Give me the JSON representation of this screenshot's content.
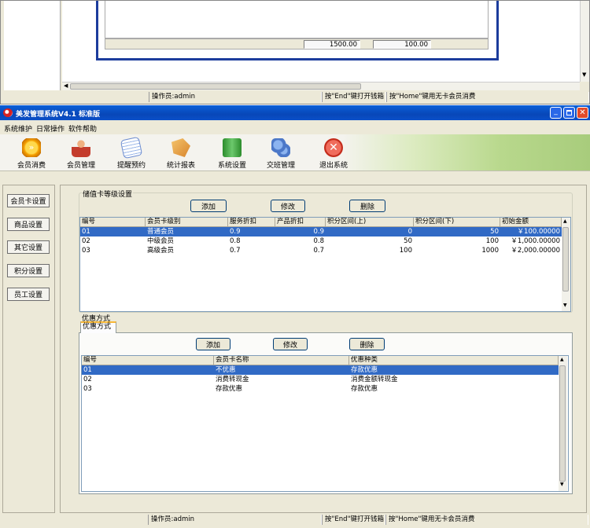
{
  "top_window": {
    "status_operator": "操作员:admin",
    "status_end": "按\"End\"键打开钱箱",
    "status_home": "按\"Home\"键用无卡会员消费",
    "totals": [
      "1500.00",
      "100.00"
    ]
  },
  "window": {
    "title": "美发管理系统V4.1 标准版",
    "menu": [
      "系统维护",
      "日常操作",
      "软件帮助"
    ],
    "toolbar": [
      {
        "label": "会员消费",
        "icon": "member-consume-icon",
        "color": "#f5a000"
      },
      {
        "label": "会员管理",
        "icon": "member-manage-icon",
        "color": "#c43c2c"
      },
      {
        "label": "提醒预约",
        "icon": "reminder-icon",
        "color": "#6c8cd0"
      },
      {
        "label": "统计报表",
        "icon": "report-icon",
        "color": "#d8842c"
      },
      {
        "label": "系统设置",
        "icon": "system-settings-icon",
        "color": "#3c9c3c"
      },
      {
        "label": "交班管理",
        "icon": "shift-handover-icon",
        "color": "#4c78c8"
      },
      {
        "label": "退出系统",
        "icon": "exit-icon",
        "color": "#d83c2c"
      }
    ]
  },
  "sidebar": [
    "会员卡设置",
    "商品设置",
    "其它设置",
    "积分设置",
    "员工设置"
  ],
  "card_levels": {
    "title": "储值卡等级设置",
    "buttons": {
      "add": "添加",
      "edit": "修改",
      "delete": "删除"
    },
    "columns": [
      "编号",
      "会员卡级别",
      "服务折扣",
      "产品折扣",
      "积分区间(上)",
      "积分区间(下)",
      "初始金额"
    ],
    "rows": [
      [
        "01",
        "普通会员",
        "0.9",
        "0.9",
        "0",
        "50",
        "￥100.00000"
      ],
      [
        "02",
        "中级会员",
        "0.8",
        "0.8",
        "50",
        "100",
        "￥1,000.00000"
      ],
      [
        "03",
        "高级会员",
        "0.7",
        "0.7",
        "100",
        "1000",
        "￥2,000.00000"
      ]
    ]
  },
  "discounts": {
    "title": "优惠方式",
    "tab": "优惠方式",
    "buttons": {
      "add": "添加",
      "edit": "修改",
      "delete": "删除"
    },
    "columns": [
      "编号",
      "会员卡名称",
      "优惠种类"
    ],
    "rows": [
      [
        "01",
        "不优惠",
        "存款优惠"
      ],
      [
        "02",
        "消费转现金",
        "消费金额转现金"
      ],
      [
        "03",
        "存款优惠",
        "存款优惠"
      ]
    ]
  },
  "status": {
    "operator": "操作员:admin",
    "end_key": "按\"End\"键打开钱箱",
    "home_key": "按\"Home\"键用无卡会员消费"
  },
  "colors": {
    "selection": "#316ac5",
    "titlebar": "#0054e3",
    "face": "#ece9d8"
  }
}
